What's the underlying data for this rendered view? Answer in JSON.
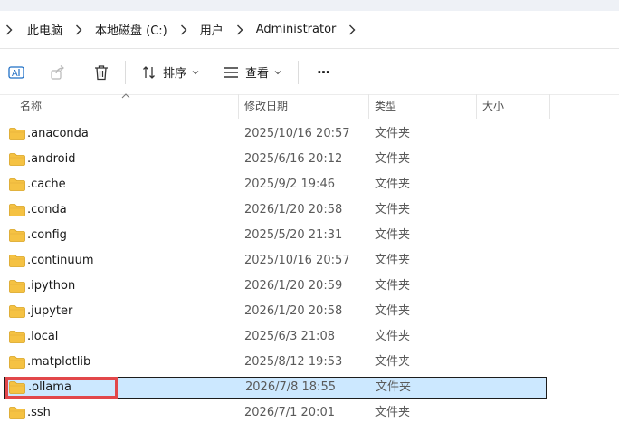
{
  "breadcrumb": {
    "items": [
      "此电脑",
      "本地磁盘 (C:)",
      "用户",
      "Administrator"
    ]
  },
  "toolbar": {
    "sort_label": "排序",
    "view_label": "查看",
    "more_label": "···"
  },
  "columns": {
    "name": "名称",
    "modified": "修改日期",
    "type": "类型",
    "size": "大小"
  },
  "files": [
    {
      "name": ".anaconda",
      "modified": "2025/10/16 20:57",
      "type": "文件夹"
    },
    {
      "name": ".android",
      "modified": "2025/6/16 20:12",
      "type": "文件夹"
    },
    {
      "name": ".cache",
      "modified": "2025/9/2 19:46",
      "type": "文件夹"
    },
    {
      "name": ".conda",
      "modified": "2026/1/20 20:58",
      "type": "文件夹"
    },
    {
      "name": ".config",
      "modified": "2025/5/20 21:31",
      "type": "文件夹"
    },
    {
      "name": ".continuum",
      "modified": "2025/10/16 20:57",
      "type": "文件夹"
    },
    {
      "name": ".ipython",
      "modified": "2026/1/20 20:59",
      "type": "文件夹"
    },
    {
      "name": ".jupyter",
      "modified": "2026/1/20 20:58",
      "type": "文件夹"
    },
    {
      "name": ".local",
      "modified": "2025/6/3 21:08",
      "type": "文件夹"
    },
    {
      "name": ".matplotlib",
      "modified": "2025/8/12 19:53",
      "type": "文件夹"
    },
    {
      "name": ".ollama",
      "modified": "2026/7/8 18:55",
      "type": "文件夹",
      "selected": true
    },
    {
      "name": ".ssh",
      "modified": "2026/7/1 20:01",
      "type": "文件夹"
    }
  ],
  "colors": {
    "selection_bg": "#cce8ff",
    "highlight_box": "#e2474a",
    "folder": "#f5c243"
  }
}
